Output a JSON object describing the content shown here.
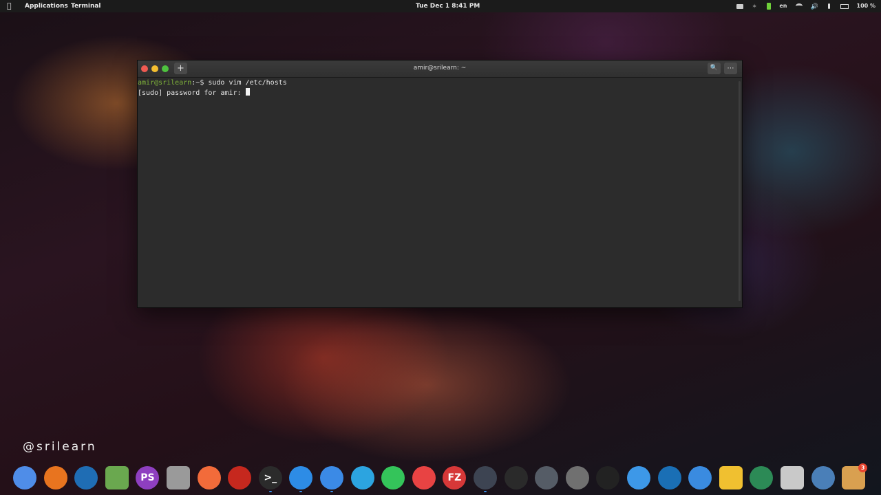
{
  "topbar": {
    "menus": [
      "Applications",
      "Terminal"
    ],
    "clock": "Tue Dec 1   8:41 PM",
    "lang": "en",
    "battery": "100 %"
  },
  "window": {
    "title": "amir@srilearn: ~",
    "new_tab": "+",
    "search_icon": "search-icon",
    "menu_icon": "more-icon"
  },
  "terminal": {
    "prompt": "amir@srilearn",
    "path": ":~$ ",
    "command": "sudo vim /etc/hosts",
    "line2": "[sudo] password for amir: "
  },
  "watermark": "@srilearn",
  "dock": [
    {
      "name": "chromium",
      "color": "#4f8de8"
    },
    {
      "name": "firefox",
      "color": "#e8741f"
    },
    {
      "name": "vscode",
      "color": "#1f6db4"
    },
    {
      "name": "image-editor",
      "color": "#6aa84f"
    },
    {
      "name": "phpstorm",
      "color": "#8e3fc0",
      "label": "PS"
    },
    {
      "name": "database",
      "color": "#9a9a9a"
    },
    {
      "name": "postman",
      "color": "#f26b3a"
    },
    {
      "name": "laravel",
      "color": "#c6281e"
    },
    {
      "name": "terminal",
      "color": "#2b2b2b",
      "label": ">_"
    },
    {
      "name": "music",
      "color": "#2d8ce6"
    },
    {
      "name": "finder",
      "color": "#3b8ae6"
    },
    {
      "name": "telegram",
      "color": "#2ca4e0"
    },
    {
      "name": "whatsapp",
      "color": "#34c45a"
    },
    {
      "name": "git-client",
      "color": "#e84343"
    },
    {
      "name": "filezilla",
      "color": "#d63838",
      "label": "FZ"
    },
    {
      "name": "video-player",
      "color": "#3d4452"
    },
    {
      "name": "obs",
      "color": "#2a2a2a"
    },
    {
      "name": "disk-utility",
      "color": "#555c66"
    },
    {
      "name": "settings",
      "color": "#707070"
    },
    {
      "name": "downloader",
      "color": "#222222"
    },
    {
      "name": "mail",
      "color": "#3d98e8"
    },
    {
      "name": "monitor",
      "color": "#1a6fb5"
    },
    {
      "name": "simplenote",
      "color": "#3a8be0"
    },
    {
      "name": "notes",
      "color": "#f0c030"
    },
    {
      "name": "timeshift",
      "color": "#2c8a56"
    },
    {
      "name": "trash",
      "color": "#c9c9c9"
    },
    {
      "name": "file-manager",
      "color": "#4a7fb8"
    },
    {
      "name": "updates",
      "color": "#d9a050",
      "badge": "3"
    }
  ]
}
